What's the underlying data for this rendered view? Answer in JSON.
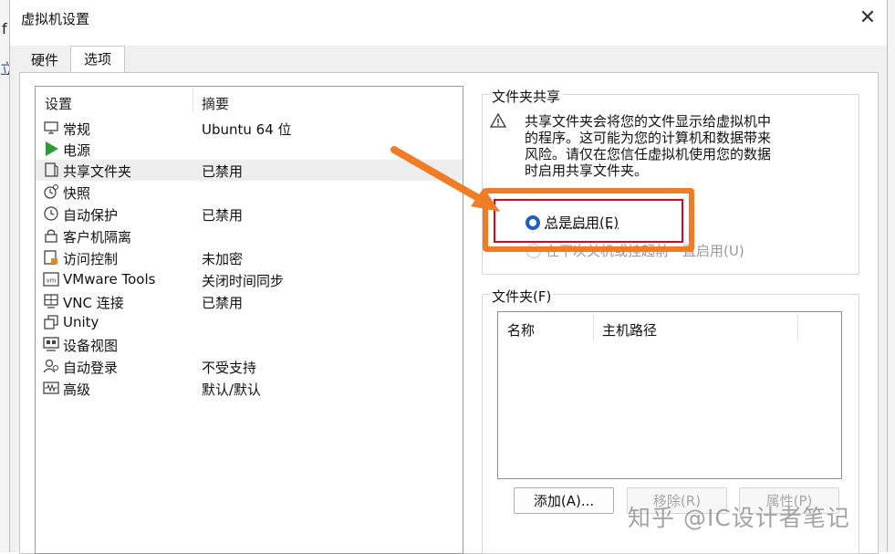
{
  "background": {
    "left_char": "f",
    "left_char2": "立"
  },
  "window": {
    "title": "虚拟机设置",
    "close_glyph": "✕"
  },
  "tabs": [
    {
      "label": "硬件"
    },
    {
      "label": "选项"
    }
  ],
  "settings": {
    "columns": [
      "设置",
      "摘要"
    ],
    "items": [
      {
        "name": "常规",
        "summary": "Ubuntu 64 位",
        "icon": "monitor-icon"
      },
      {
        "name": "电源",
        "summary": "",
        "icon": "play-icon"
      },
      {
        "name": "共享文件夹",
        "summary": "已禁用",
        "icon": "shared-folder-icon"
      },
      {
        "name": "快照",
        "summary": "",
        "icon": "snapshot-icon"
      },
      {
        "name": "自动保护",
        "summary": "已禁用",
        "icon": "clock-icon"
      },
      {
        "name": "客户机隔离",
        "summary": "",
        "icon": "lock-icon"
      },
      {
        "name": "访问控制",
        "summary": "未加密",
        "icon": "access-control-icon"
      },
      {
        "name": "VMware Tools",
        "summary": "关闭时间同步",
        "icon": "vm-icon"
      },
      {
        "name": "VNC 连接",
        "summary": "已禁用",
        "icon": "vnc-icon"
      },
      {
        "name": "Unity",
        "summary": "",
        "icon": "unity-icon"
      },
      {
        "name": "设备视图",
        "summary": "",
        "icon": "device-view-icon"
      },
      {
        "name": "自动登录",
        "summary": "不受支持",
        "icon": "auto-login-icon"
      },
      {
        "name": "高级",
        "summary": "默认/默认",
        "icon": "advanced-icon"
      }
    ]
  },
  "folder_sharing": {
    "title": "文件夹共享",
    "warning_lines": [
      "共享文件夹会将您的文件显示给虚拟机中",
      "的程序。这可能为您的计算机和数据带来",
      "风险。请仅在您信任虚拟机使用您的数据",
      "时启用共享文件夹。"
    ],
    "options": [
      {
        "label": "总是启用(E)",
        "selected": true
      },
      {
        "label": "在下次关机或挂起前一直启用(U)",
        "selected": false
      }
    ]
  },
  "folders": {
    "title": "文件夹(F)",
    "columns": [
      "名称",
      "主机路径"
    ],
    "buttons": [
      {
        "label": "添加(A)...",
        "enabled": true
      },
      {
        "label": "移除(R)",
        "enabled": false
      },
      {
        "label": "属性(P)",
        "enabled": false
      }
    ]
  },
  "watermark": "知乎 @IC设计者笔记",
  "colors": {
    "highlight_orange": "#f07d26",
    "highlight_red": "#e2001a",
    "radio_blue": "#1f5fb8"
  }
}
